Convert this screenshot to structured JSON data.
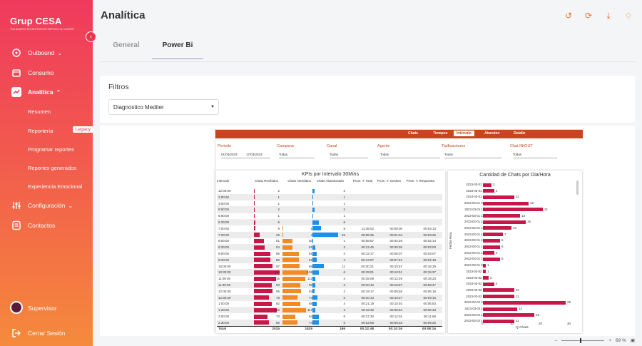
{
  "brand": {
    "logo": "Grup CESA",
    "tagline": "TUS ALIADOS EN GESTIÓN DE SERVICIO AL CLIENTE"
  },
  "sidebar": {
    "items": [
      {
        "label": "Outbound",
        "icon": "megaphone-icon",
        "has_chevron": true
      },
      {
        "label": "Consumo",
        "icon": "calendar-icon"
      },
      {
        "label": "Analítica",
        "icon": "analytics-icon",
        "has_chevron": true,
        "active": true
      },
      {
        "label": "Configuración",
        "icon": "sliders-icon",
        "has_chevron": true
      },
      {
        "label": "Contactos",
        "icon": "contacts-icon"
      }
    ],
    "sub_items": [
      "Resumen",
      "Reportería",
      "Programar reportes",
      "Reportes generados",
      "Experiencia Emocional"
    ],
    "legacy_badge": "Legacy",
    "user": "Supervisor",
    "logout": "Cerrar Sesión"
  },
  "header": {
    "title": "Analítica",
    "icons": [
      "history-icon",
      "sync-icon",
      "download-icon",
      "bell-icon"
    ]
  },
  "tabs": [
    "General",
    "Power Bi"
  ],
  "filters": {
    "title": "Filtros",
    "selected": "Diagnostico Mediter"
  },
  "report": {
    "nav": [
      "Chats",
      "Tiempos",
      "Intervalo",
      "Atencion",
      "Detalle"
    ],
    "nav_selected": "Intervalo",
    "filters": [
      {
        "label": "Periodo",
        "values": [
          "01/03/2023",
          "17/03/2023"
        ]
      },
      {
        "label": "Campana",
        "values": [
          "Todas"
        ]
      },
      {
        "label": "Canal",
        "values": [
          "Todas"
        ]
      },
      {
        "label": "Agente",
        "values": [
          "Todas"
        ]
      },
      {
        "label": "Tipificaciones",
        "values": [
          "Todas"
        ]
      },
      {
        "label": "Chat IN/OUT",
        "values": [
          "Todas"
        ]
      }
    ],
    "kpi": {
      "title": "KPIs por Intervalo 30Mins",
      "headers": [
        "Intervalo",
        "Chats Recibidos",
        "Chats Atendidos",
        "Chats Abandonado",
        "Prom. T. Total",
        "Prom. T. Gestion",
        "Prom. T. Respuesta"
      ],
      "rows": [
        [
          "12:00:00",
          "2",
          "",
          "2",
          "",
          "",
          ""
        ],
        [
          "2:00:00",
          "1",
          "",
          "1",
          "",
          "",
          ""
        ],
        [
          "3:00:00",
          "1",
          "",
          "1",
          "",
          "",
          ""
        ],
        [
          "5:00:00",
          "2",
          "",
          "2",
          "",
          "",
          ""
        ],
        [
          "6:00:00",
          "1",
          "",
          "1",
          "",
          "",
          ""
        ],
        [
          "6:30:00",
          "6",
          "",
          "6",
          "",
          "",
          ""
        ],
        [
          "7:00:00",
          "9",
          "1",
          "8",
          "11:35:02",
          "00:00:00",
          "00:03:13"
        ],
        [
          "7:30:00",
          "29",
          "4",
          "25",
          "08:58:35",
          "00:01:04",
          "00:53:25"
        ],
        [
          "8:00:00",
          "51",
          "50",
          "1",
          "00:08:57",
          "00:04:26",
          "00:02:14"
        ],
        [
          "8:30:00",
          "54",
          "51",
          "3",
          "00:12:46",
          "00:06:30",
          "00:03:03"
        ],
        [
          "9:00:00",
          "85",
          "81",
          "4",
          "00:12:17",
          "00:06:07",
          "00:03:07"
        ],
        [
          "9:30:00",
          "86",
          "82",
          "4",
          "00:13:07",
          "00:07:42",
          "00:02:48"
        ],
        [
          "10:00:00",
          "97",
          "86",
          "11",
          "00:30:21",
          "00:10:57",
          "00:16:29"
        ],
        [
          "10:30:00",
          "134",
          "128",
          "6",
          "00:29:01",
          "00:10:51",
          "00:15:37"
        ],
        [
          "11:00:00",
          "115",
          "112",
          "3",
          "00:35:09",
          "00:13:29",
          "00:18:23"
        ],
        [
          "11:30:00",
          "93",
          "90",
          "3",
          "00:20:46",
          "00:10:57",
          "00:08:47"
        ],
        [
          "12:00:00",
          "95",
          "93",
          "2",
          "00:19:17",
          "00:08:58",
          "00:06:18"
        ],
        [
          "12:30:00",
          "79",
          "74",
          "5",
          "00:20:13",
          "00:10:27",
          "00:04:16"
        ],
        [
          "1:00:00",
          "92",
          "88",
          "4",
          "00:21:19",
          "00:10:40",
          "00:06:53"
        ],
        [
          "1:30:00",
          "120",
          "117",
          "3",
          "00:19:36",
          "00:08:52",
          "00:06:43"
        ],
        [
          "2:00:00",
          "70",
          "64",
          "6",
          "00:27:30",
          "00:12:01",
          "00:11:58"
        ],
        [
          "2:30:00",
          "80",
          "74",
          "6",
          "00:22:56",
          "00:09:33",
          "00:09:25"
        ]
      ],
      "total": [
        "Total",
        "2015",
        "1829",
        "186",
        "00:22:48",
        "00:10:26",
        "00:08:16"
      ]
    },
    "distribution": {
      "title": "Cantidad de Chats por Dia/Hora",
      "ylabel": "Fecha Hora",
      "xlabel": "Q Chats",
      "xticks": [
        "0",
        "10",
        "20",
        "30"
      ],
      "xmax": 30,
      "rows": [
        [
          "2023-03-01 7",
          3
        ],
        [
          "2023-03-01 8",
          4
        ],
        [
          "2023-03-01 9",
          11
        ],
        [
          "2023-03-01 10",
          16
        ],
        [
          "2023-03-01 11",
          21
        ],
        [
          "2023-03-01 12",
          13
        ],
        [
          "2023-03-01 13",
          15
        ],
        [
          "2023-03-01 14",
          10
        ],
        [
          "2023-03-01 15",
          7
        ],
        [
          "2023-03-01 16",
          6
        ],
        [
          "2023-03-01 17",
          6
        ],
        [
          "2023-03-01 18",
          4
        ],
        [
          "2023-03-01 19",
          6
        ],
        [
          "2023-03-01 20",
          1
        ],
        [
          "2023-03-02 5",
          1
        ],
        [
          "2023-03-02 6",
          2
        ],
        [
          "2023-03-02 7",
          4
        ],
        [
          "2023-03-02 8",
          11
        ],
        [
          "2023-03-02 9",
          11
        ],
        [
          "2023-03-02 10",
          29
        ],
        [
          "2023-03-02 11",
          12
        ],
        [
          "2023-03-02 12",
          18
        ],
        [
          "2023-03-02 13",
          11
        ]
      ]
    }
  },
  "zoom": "69 %"
}
